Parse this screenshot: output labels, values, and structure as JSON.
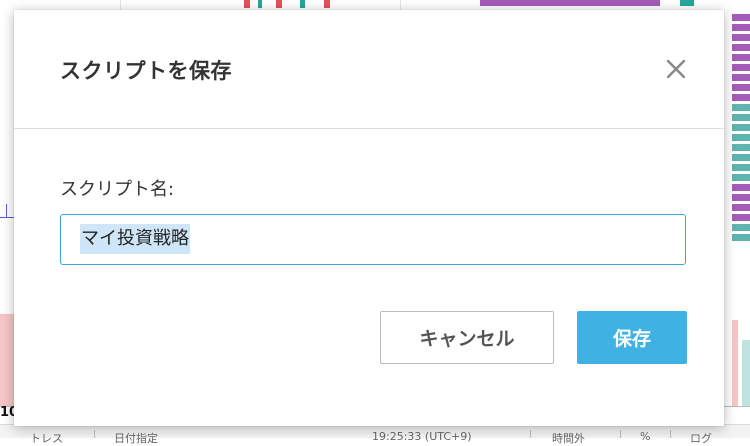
{
  "dialog": {
    "title": "スクリプトを保存",
    "close_icon": "close-icon",
    "field_label": "スクリプト名:",
    "name_value": "マイ投資戦略",
    "cancel_label": "キャンセル",
    "save_label": "保存"
  },
  "background": {
    "axis_label": "10",
    "footer_items": [
      "トレス",
      "日付指定",
      "19:25:33 (UTC+9)",
      "時間外",
      "%",
      "ログ"
    ]
  },
  "colors": {
    "accent": "#3fb1e3",
    "input_border": "#3ea8dc",
    "selection": "#cfe6f8",
    "title_text": "#333333"
  }
}
